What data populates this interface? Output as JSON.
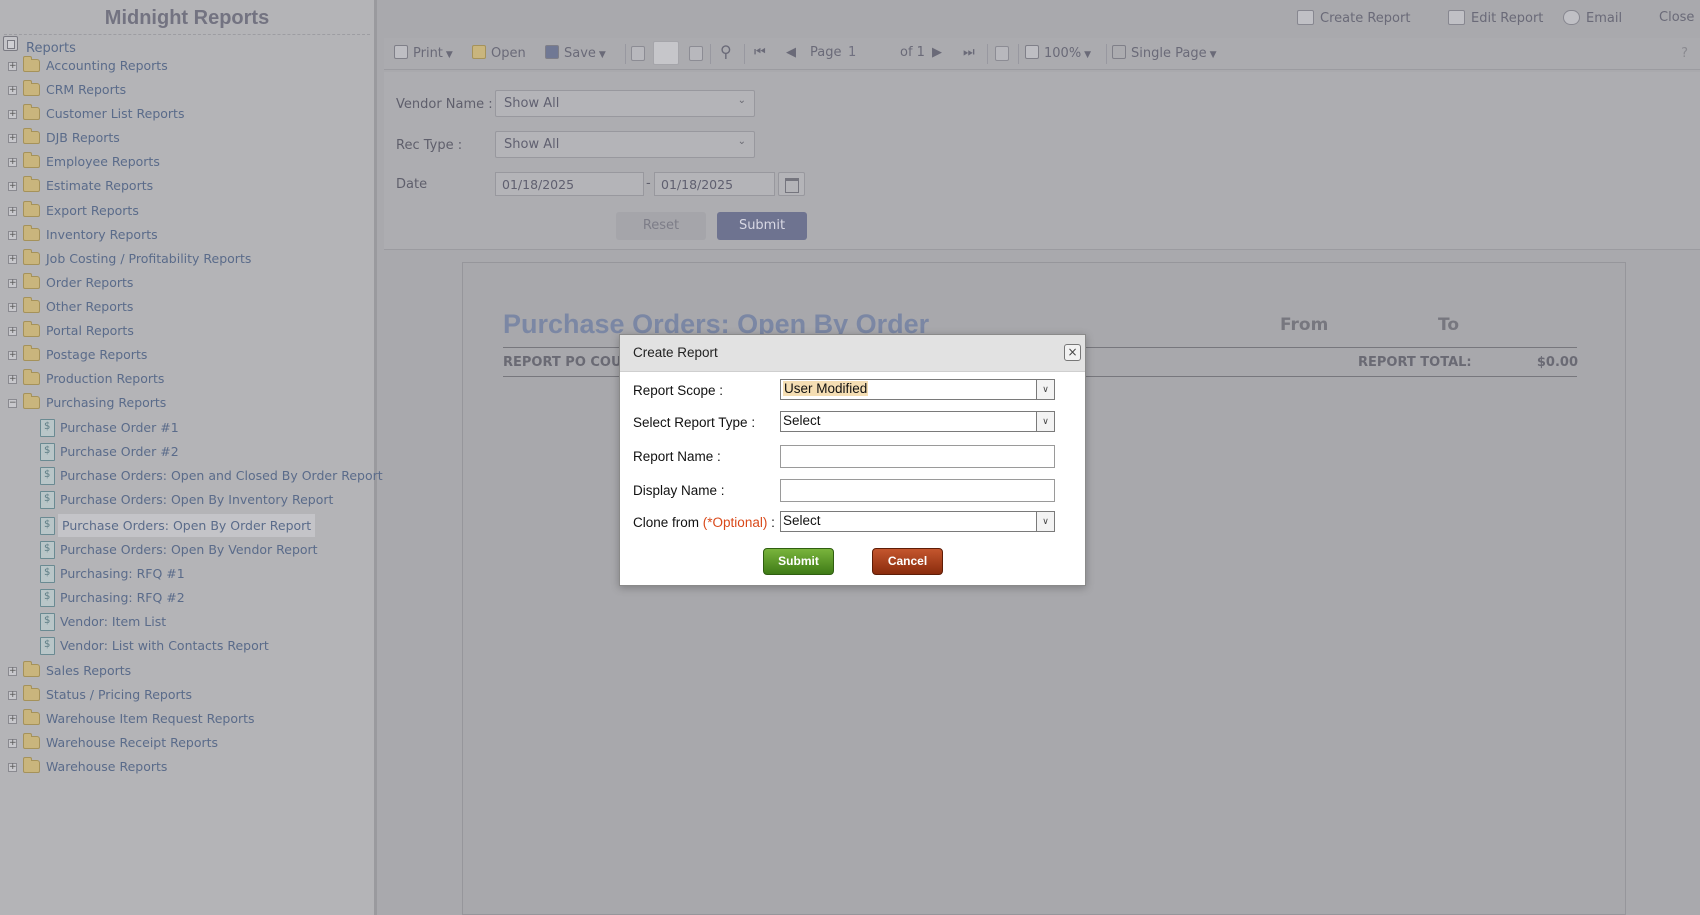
{
  "sidebar": {
    "title": "Midnight Reports",
    "root_label": "Reports",
    "folders_top": [
      {
        "label": "Accounting Reports",
        "expander": "+"
      },
      {
        "label": "CRM Reports",
        "expander": "+"
      },
      {
        "label": "Customer List Reports",
        "expander": "+"
      },
      {
        "label": "DJB Reports",
        "expander": "+"
      },
      {
        "label": "Employee Reports",
        "expander": "+"
      },
      {
        "label": "Estimate Reports",
        "expander": "+"
      },
      {
        "label": "Export Reports",
        "expander": "+"
      },
      {
        "label": "Inventory Reports",
        "expander": "+"
      },
      {
        "label": "Job Costing / Profitability Reports",
        "expander": "+"
      },
      {
        "label": "Order Reports",
        "expander": "+"
      },
      {
        "label": "Other Reports",
        "expander": "+"
      },
      {
        "label": "Portal Reports",
        "expander": "+"
      },
      {
        "label": "Postage Reports",
        "expander": "+"
      },
      {
        "label": "Production Reports",
        "expander": "+"
      },
      {
        "label": "Purchasing Reports",
        "expander": "−"
      }
    ],
    "purchasing_reports": [
      {
        "label": "Purchase Order #1"
      },
      {
        "label": "Purchase Order #2"
      },
      {
        "label": "Purchase Orders: Open and Closed By Order Report"
      },
      {
        "label": "Purchase Orders: Open By Inventory Report"
      },
      {
        "label": "Purchase Orders: Open By Order Report",
        "selected": true
      },
      {
        "label": "Purchase Orders: Open By Vendor Report"
      },
      {
        "label": "Purchasing: RFQ #1"
      },
      {
        "label": "Purchasing: RFQ #2"
      },
      {
        "label": "Vendor: Item List"
      },
      {
        "label": "Vendor: List with Contacts Report"
      }
    ],
    "folders_bottom": [
      {
        "label": "Sales Reports",
        "expander": "+"
      },
      {
        "label": "Status / Pricing Reports",
        "expander": "+"
      },
      {
        "label": "Warehouse Item Request Reports",
        "expander": "+"
      },
      {
        "label": "Warehouse Receipt Reports",
        "expander": "+"
      },
      {
        "label": "Warehouse Reports",
        "expander": "+"
      }
    ]
  },
  "top_actions": {
    "create_report": "Create Report",
    "edit_report": "Edit Report",
    "email": "Email",
    "close": "Close"
  },
  "toolbar": {
    "print": "Print",
    "open": "Open",
    "save": "Save",
    "page_label": "Page",
    "page_value": "1",
    "page_of": "of 1",
    "zoom": "100%",
    "view_mode": "Single Page",
    "help": "?"
  },
  "filters": {
    "vendor_label": "Vendor Name :",
    "vendor_value": "Show All",
    "rectype_label": "Rec Type :",
    "rectype_value": "Show All",
    "date_label": "Date",
    "date_from": "01/18/2025",
    "date_sep": "-",
    "date_to": "01/18/2025",
    "reset": "Reset",
    "submit": "Submit"
  },
  "report": {
    "title": "Purchase Orders: Open By Order",
    "from": "From",
    "to": "To",
    "po_count_label": "REPORT PO COUNT",
    "total_label": "REPORT TOTAL:",
    "total_value": "$0.00"
  },
  "modal": {
    "title": "Create Report",
    "close_glyph": "×",
    "scope_label": "Report Scope :",
    "scope_value": "User Modified",
    "type_label": "Select Report Type :",
    "type_value": "Select",
    "name_label": "Report Name :",
    "name_value": "",
    "display_label": "Display Name :",
    "display_value": "",
    "clone_label": "Clone from",
    "clone_optional": "(*Optional)",
    "clone_colon": ":",
    "clone_value": "Select",
    "submit": "Submit",
    "cancel": "Cancel"
  }
}
